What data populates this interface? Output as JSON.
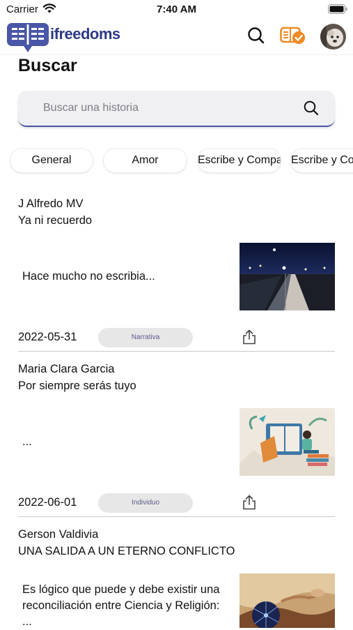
{
  "status_bar": {
    "carrier": "Carrier",
    "time": "7:40 AM"
  },
  "app": {
    "name": "ifreedoms"
  },
  "page": {
    "title": "Buscar"
  },
  "search": {
    "placeholder": "Buscar una historia"
  },
  "categories": [
    "General",
    "Amor",
    "Escribe y Comparte",
    "Escribe y Comparte"
  ],
  "posts": [
    {
      "author": "J Alfredo MV",
      "title": "Ya ni recuerdo",
      "excerpt": "Hace mucho no escribia...",
      "date": "2022-05-31",
      "category": "Narrativa",
      "image": "night-bridge-photo"
    },
    {
      "author": "Maria Clara Garcia",
      "title": "Por siempre serás tuyo",
      "excerpt": "...",
      "date": "2022-06-01",
      "category": "Individuo",
      "image": "reading-girl-illustration"
    },
    {
      "author": "Gerson Valdivia",
      "title": "UNA SALIDA A UN ETERNO CONFLICTO",
      "excerpt": "Es lógico que puede y debe existir una reconciliación entre Ciencia y Religión: ...",
      "image": "creation-of-adam-art"
    }
  ],
  "icons": {
    "search": "search-icon",
    "read": "book-check-icon",
    "share": "share-icon",
    "wifi": "wifi-icon",
    "battery": "battery-icon"
  },
  "colors": {
    "brand": "#2e3a86",
    "logo_blue": "#4a56a6",
    "accent_orange": "#f08a24",
    "search_underline": "#4a56a6"
  }
}
